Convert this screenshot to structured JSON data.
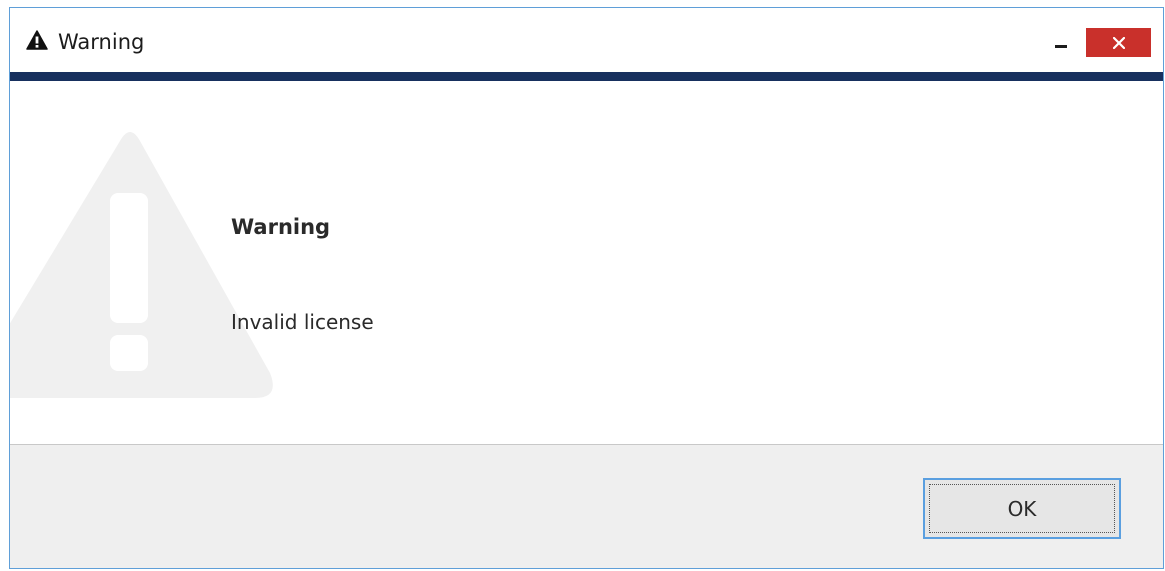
{
  "window": {
    "title": "Warning",
    "title_icon": "warning-triangle-icon",
    "accent_color": "#17305e",
    "close_color": "#c9302b"
  },
  "titlebar_buttons": {
    "minimize_icon": "minimize-icon",
    "close_icon": "close-icon"
  },
  "message": {
    "heading": "Warning",
    "body": "Invalid license",
    "background_icon": "warning-exclamation-icon"
  },
  "footer": {
    "ok_label": "OK"
  }
}
